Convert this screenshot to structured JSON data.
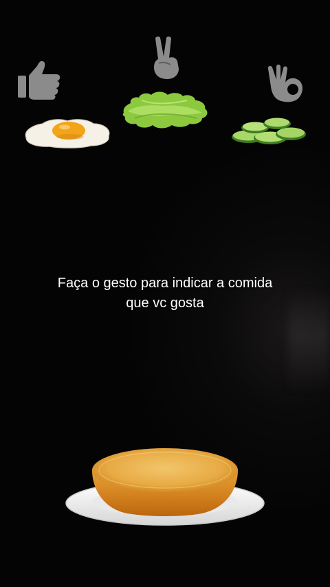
{
  "instruction": {
    "line1": "Faça o gesto para indicar a comida",
    "line2": "que vc gosta"
  },
  "options": [
    {
      "gesture": "thumbs-up-icon",
      "food": "fried-egg"
    },
    {
      "gesture": "peace-sign-icon",
      "food": "lettuce"
    },
    {
      "gesture": "ok-hand-icon",
      "food": "cucumber-slices"
    }
  ],
  "assembly": {
    "item": "burger-bun-bottom",
    "base": "white-plate"
  },
  "colors": {
    "background": "#050405",
    "gesture": "#8b8b8b",
    "text": "#ffffff",
    "bun": "#e3982e",
    "egg_yolk": "#f2a41a",
    "lettuce": "#9bd64a",
    "cucumber": "#8fc94c",
    "plate": "#f4f4f4"
  }
}
